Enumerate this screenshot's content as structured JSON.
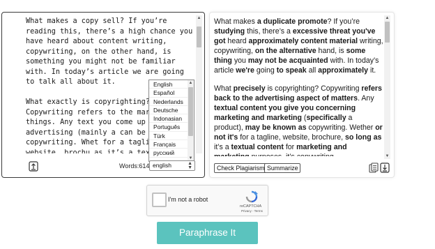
{
  "input": {
    "paragraphs": [
      "What makes a copy sell? If you’re reading this, there’s a high chance you have heard about content writing, copywriting, on the other hand, is something you might not be familiar with. In today’s article we are going to talk all about it.",
      "What exactly is copyrighting? Copywriting refers to the marke of things. Any text you come up regarding advertising (mainly a can be called copywriting. Whet for a tagline, website, brochu as it’s a text for advertising it’s copywriting."
    ],
    "word_count": "Words:614",
    "language_selected": "english",
    "language_options": [
      "English",
      "Español",
      "Nederlands",
      "Deutsche",
      "Indonasian",
      "Português",
      "Türk",
      "Français",
      "русский"
    ]
  },
  "output": {
    "paragraphs": [
      [
        {
          "t": "What makes "
        },
        {
          "t": "a duplicate promote",
          "b": true
        },
        {
          "t": "? If you’re "
        },
        {
          "t": "studying",
          "b": true
        },
        {
          "t": " this, there’s a "
        },
        {
          "t": "excessive threat you've got",
          "b": true
        },
        {
          "t": " heard "
        },
        {
          "t": "approximately content material",
          "b": true
        },
        {
          "t": " writing, copywriting, "
        },
        {
          "t": "on the alternative",
          "b": true
        },
        {
          "t": " hand, is "
        },
        {
          "t": "some thing",
          "b": true
        },
        {
          "t": " you "
        },
        {
          "t": "may not be acquainted",
          "b": true
        },
        {
          "t": " with. In today’s article "
        },
        {
          "t": "we're",
          "b": true
        },
        {
          "t": " going "
        },
        {
          "t": "to speak",
          "b": true
        },
        {
          "t": " all "
        },
        {
          "t": "approximately",
          "b": true
        },
        {
          "t": " it."
        }
      ],
      [
        {
          "t": "What "
        },
        {
          "t": "precisely",
          "b": true
        },
        {
          "t": " is copyrighting? Copywriting "
        },
        {
          "t": "refers back to the advertising aspect of matters",
          "b": true
        },
        {
          "t": ". Any "
        },
        {
          "t": "textual content you",
          "b": true
        },
        {
          "t": " "
        },
        {
          "t": "give you concerning marketing and marketing",
          "b": true
        },
        {
          "t": " ("
        },
        {
          "t": "specifically",
          "b": true
        },
        {
          "t": " a product), "
        },
        {
          "t": "may be known as",
          "b": true
        },
        {
          "t": " copywriting. Wether "
        },
        {
          "t": "or not it's",
          "b": true
        },
        {
          "t": " for a tagline, website, brochure, "
        },
        {
          "t": "so long as",
          "b": true
        },
        {
          "t": " it’s a "
        },
        {
          "t": "textual content",
          "b": true
        },
        {
          "t": " for "
        },
        {
          "t": "marketing and marketing",
          "b": true
        },
        {
          "t": " purposes, it’s copywriting."
        }
      ]
    ],
    "check_plagiarism_label": "Check Plagiarism",
    "summarize_label": "Summarize"
  },
  "captcha": {
    "label": "I'm not a robot",
    "brand": "reCAPTCHA",
    "terms": "Privacy - Terms"
  },
  "paraphrase_button": "Paraphrase It",
  "colors": {
    "accent": "#5bc3be",
    "border_dark": "#3a3a3a"
  }
}
